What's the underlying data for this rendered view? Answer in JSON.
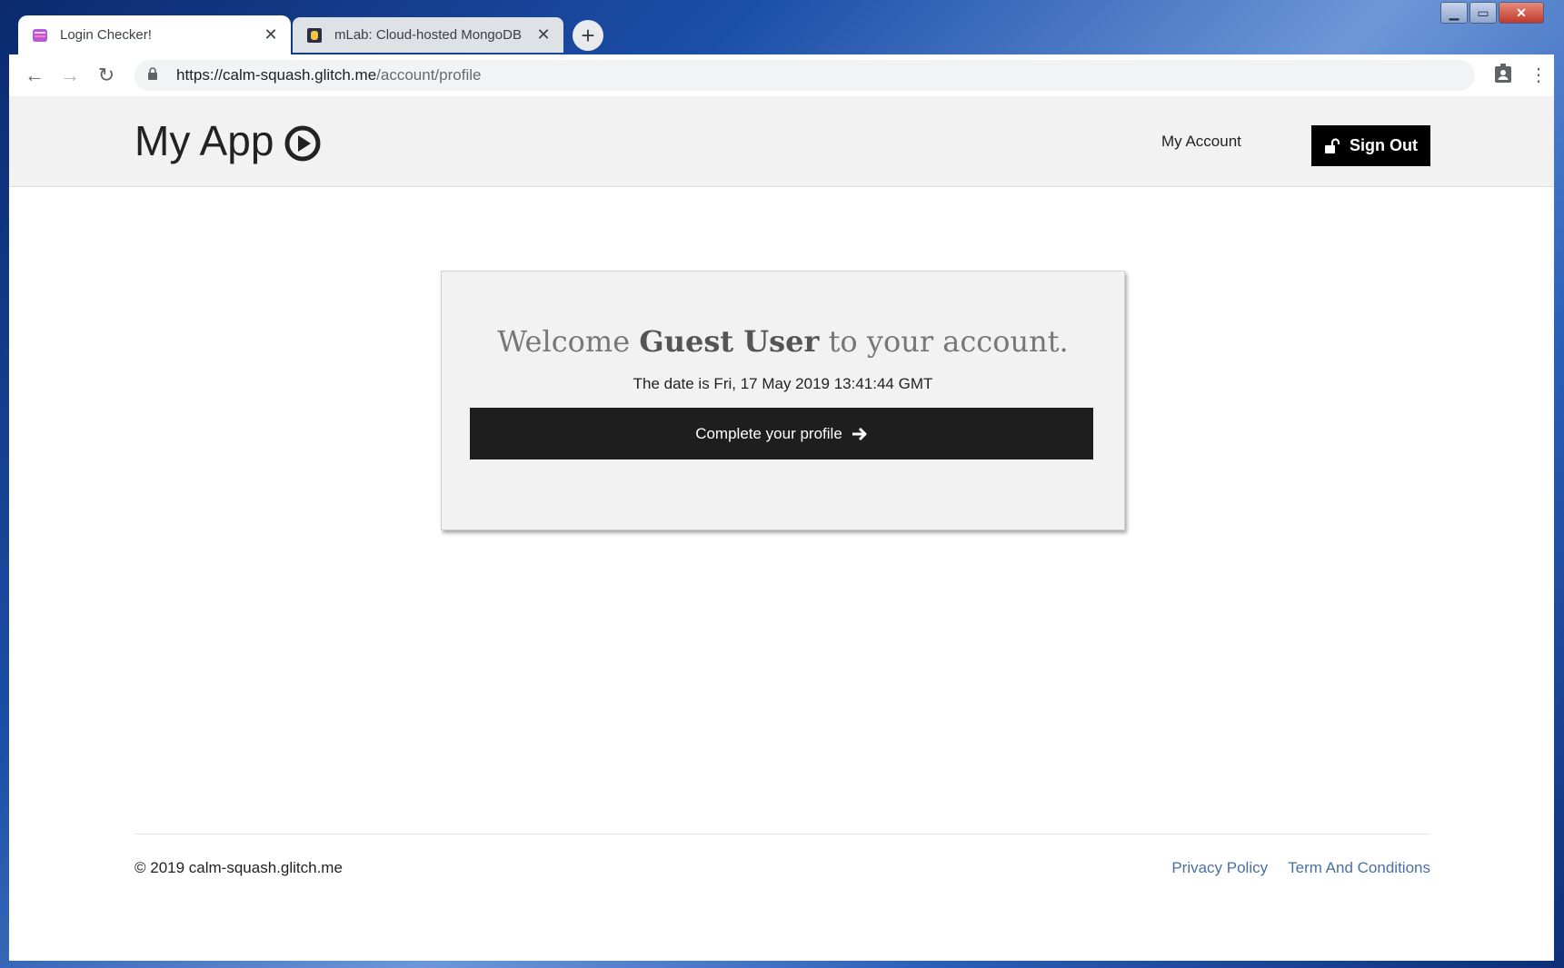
{
  "browser": {
    "tabs": [
      {
        "title": "Login Checker!",
        "active": true,
        "favicon": "glitch-icon"
      },
      {
        "title": "mLab: Cloud-hosted MongoDB",
        "active": false,
        "favicon": "mlab-icon"
      }
    ],
    "close_glyph": "✕",
    "new_tab_glyph": "+",
    "window_controls": {
      "minimize": "▁",
      "maximize": "▭",
      "close": "✕"
    },
    "nav": {
      "back": "←",
      "forward": "→",
      "reload": "↻"
    },
    "url": {
      "host": "https://calm-squash.glitch.me",
      "path": "/account/profile"
    },
    "menu_glyph": "⋮"
  },
  "header": {
    "brand": "My App",
    "nav_account": "My Account",
    "signout_label": "Sign Out"
  },
  "card": {
    "welcome_prefix": "Welcome ",
    "user_name": "Guest User",
    "welcome_suffix": " to your account.",
    "date_text": "The date is Fri, 17 May 2019 13:41:44 GMT",
    "cta_label": "Complete your profile"
  },
  "footer": {
    "copyright": "© 2019 calm-squash.glitch.me",
    "privacy": "Privacy Policy",
    "terms": "Term And Conditions"
  },
  "colors": {
    "header_bg": "#f2f2f2",
    "button_bg": "#000000",
    "link": "#4a6fa5"
  }
}
